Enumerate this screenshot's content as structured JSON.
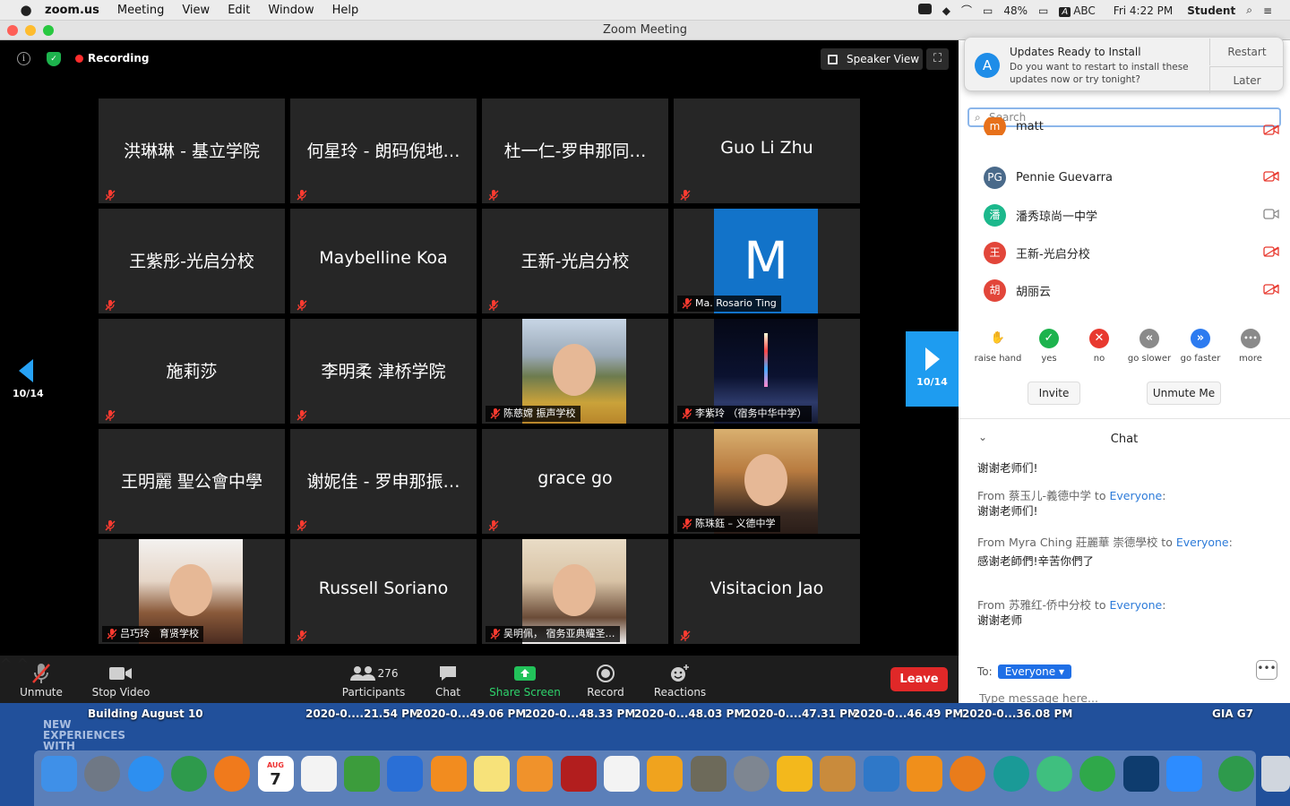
{
  "menubar": {
    "apple": "",
    "app": "zoom.us",
    "items": [
      "Meeting",
      "View",
      "Edit",
      "Window",
      "Help"
    ],
    "battery": "48%",
    "input_badge": "A",
    "input": "ABC",
    "clock": "Fri 4:22 PM",
    "user": "Student"
  },
  "window": {
    "title": "Zoom Meeting"
  },
  "meeting": {
    "recording": "Recording",
    "speaker_view": "Speaker View",
    "page_prev": "10/14",
    "page_next": "10/14"
  },
  "tiles": [
    {
      "name": "洪琳琳 - 基立学院"
    },
    {
      "name": "何星玲 - 朗码倪地…"
    },
    {
      "name": "杜一仁-罗申那同…"
    },
    {
      "name": "Guo Li Zhu"
    },
    {
      "name": "王紫彤-光启分校"
    },
    {
      "name": "Maybelline Koa"
    },
    {
      "name": "王新-光启分校"
    },
    {
      "label": "Ma. Rosario Ting",
      "avatar": "M"
    },
    {
      "name": "施莉莎"
    },
    {
      "name": "李明柔 津桥学院"
    },
    {
      "label": "陈慈嫦 振声学校"
    },
    {
      "label": "李紫玲 （宿务中华中学）"
    },
    {
      "name": "王明麗 聖公會中學"
    },
    {
      "name": "谢妮佳 - 罗申那振…"
    },
    {
      "name": "grace go"
    },
    {
      "label": "陈珠鈺 – 义德中学"
    },
    {
      "label": "吕巧玲　育贤学校"
    },
    {
      "name": "Russell Soriano"
    },
    {
      "label": "吴明佩，  宿务亚典耀圣…"
    },
    {
      "name": "Visitacion Jao"
    }
  ],
  "toolbar": {
    "unmute": "Unmute",
    "stop_video": "Stop Video",
    "participants": "Participants",
    "participant_count": "276",
    "chat": "Chat",
    "share": "Share Screen",
    "record": "Record",
    "reactions": "Reactions",
    "leave": "Leave"
  },
  "notification": {
    "title": "Updates Ready to Install",
    "body": "Do you want to restart to install these updates now or try tonight?",
    "restart": "Restart",
    "later": "Later"
  },
  "participants_panel": {
    "search_placeholder": "Search",
    "people": [
      {
        "initials": "m",
        "name": "matt",
        "color": "#e7711b"
      },
      {
        "initials": "PG",
        "name": "Pennie Guevarra",
        "color": "#4a6a8a"
      },
      {
        "initials": "潘",
        "name": "潘秀琼尚一中学",
        "color": "#1cb88c"
      },
      {
        "initials": "王",
        "name": "王新-光启分校",
        "color": "#e2463a"
      },
      {
        "initials": "胡",
        "name": "胡丽云",
        "color": "#e2463a"
      }
    ],
    "reactions": [
      {
        "label": "raise hand",
        "symbol": "✋",
        "color": "#3b7ee0"
      },
      {
        "label": "yes",
        "symbol": "✓",
        "color": "#1db34d"
      },
      {
        "label": "no",
        "symbol": "✕",
        "color": "#e8392f"
      },
      {
        "label": "go slower",
        "symbol": "«",
        "color": "#8a8a8a"
      },
      {
        "label": "go faster",
        "symbol": "»",
        "color": "#2d7bf0"
      },
      {
        "label": "more",
        "symbol": "•••",
        "color": "#8a8a8a"
      }
    ],
    "invite": "Invite",
    "unmute_me": "Unmute Me"
  },
  "chat": {
    "title": "Chat",
    "m1": "谢谢老师们!",
    "m2_from": "From 蔡玉儿-義德中学 to ",
    "m2_to": "Everyone",
    "m2": "谢谢老师们!",
    "m3_from": "From Myra Ching 莊麗華 崇德學校 to ",
    "m3_to": "Everyone",
    "m3": "感谢老師們!辛苦你們了",
    "m4_from": "From 苏雅红-侨中分校 to ",
    "m4_to": "Everyone",
    "m4": "谢谢老师",
    "to_label": "To:",
    "to_value": "Everyone",
    "more_icon": "•••",
    "placeholder": "Type message here..."
  },
  "desktop": {
    "bg_text": "NEW EXPERIENCES WITH",
    "labels": [
      "Building August 10",
      "2020-0....21.54 PM",
      "2020-0...49.06 PM",
      "2020-0...48.33 PM",
      "2020-0...48.03 PM",
      "2020-0....47.31 PM",
      "2020-0...46.49 PM",
      "2020-0...36.08 PM",
      "GIA G7"
    ]
  },
  "dock": {
    "calendar_month": "AUG",
    "calendar_day": "7",
    "apps": [
      "finder",
      "launchpad",
      "safari",
      "chrome",
      "firefox",
      "calendar",
      "textedit",
      "numbers",
      "keynote",
      "books",
      "notes",
      "pages",
      "photo-booth",
      "pencil",
      "scratch",
      "gimp",
      "system-prefs",
      "moodle",
      "packages",
      "preview",
      "drawio",
      "blender",
      "arduino",
      "atom",
      "evernote",
      "vimeo",
      "zoom",
      "chrome-desktop",
      "trash"
    ],
    "colors": [
      "#3f90e8",
      "#6f7885",
      "#2d8ff0",
      "#2e9a4c",
      "#f07a1c",
      "#ffffff",
      "#f3f3f3",
      "#3c9c3c",
      "#2a6fd6",
      "#f28c1f",
      "#f7e27a",
      "#f0922b",
      "#b21e1e",
      "#f3f3f3",
      "#f0a31e",
      "#6d6a5a",
      "#7e8691",
      "#f3b81c",
      "#c98b3c",
      "#2f78c8",
      "#f08f1b",
      "#e97c1b",
      "#1a9a97",
      "#3fbf7f",
      "#2fa84a",
      "#0e3c6e",
      "#2d8cff",
      "#2e9a4c",
      "#d0d6de"
    ]
  }
}
